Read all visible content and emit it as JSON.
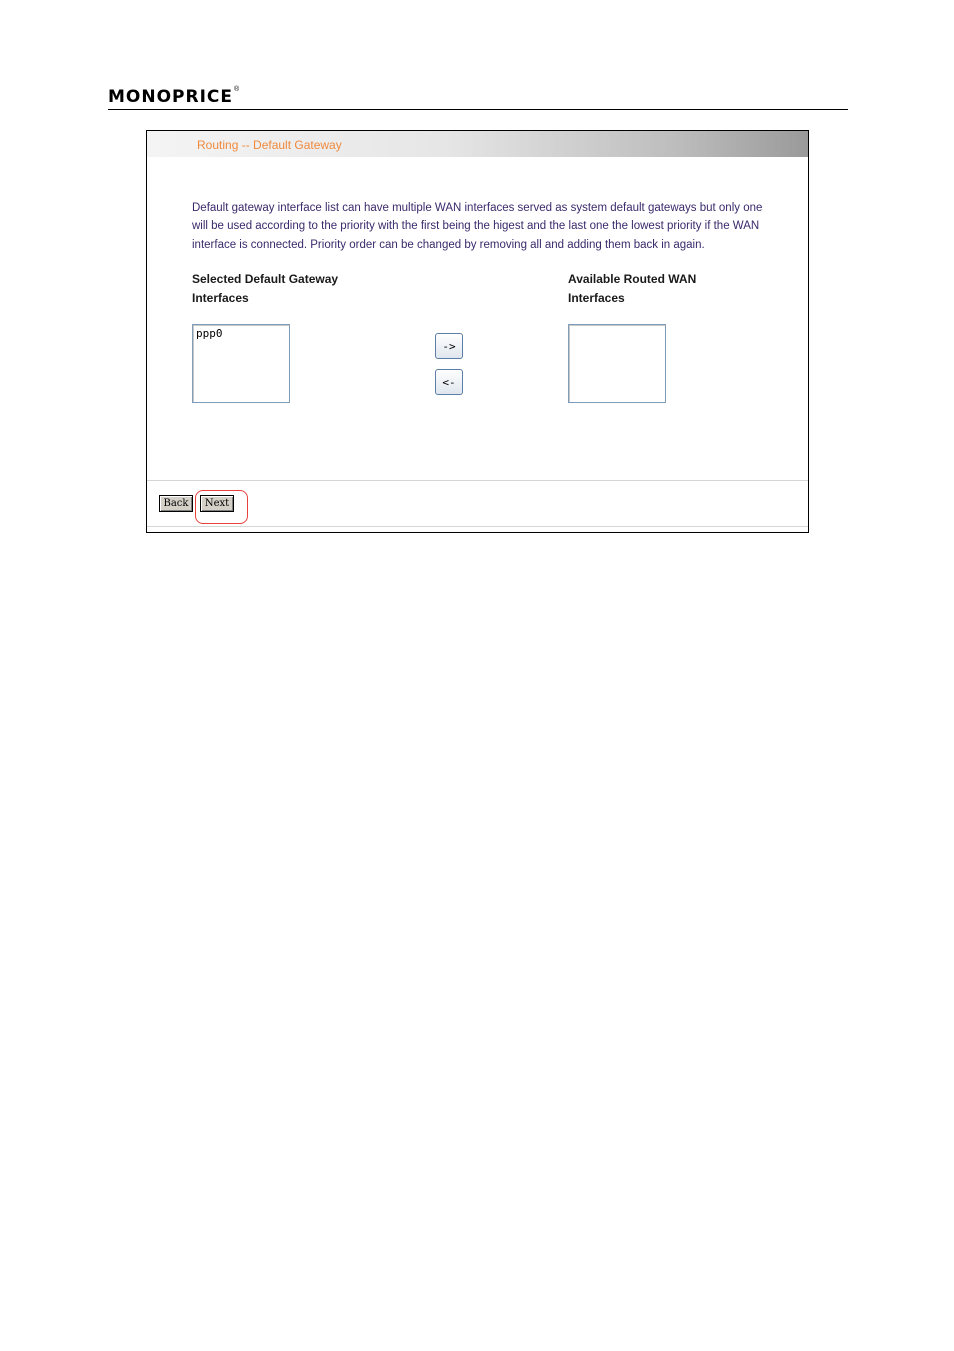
{
  "header": {
    "brand": "MONOPRICE",
    "trademark": "®"
  },
  "screen": {
    "title": "Routing -- Default Gateway",
    "description": [
      "Default gateway interface list can have multiple WAN interfaces served as system default gateways but only one",
      "will be used according to the priority with the first being the higest and the last one the lowest priority if the WAN",
      "interface is connected. Priority order can be changed by removing all and adding them back in again."
    ],
    "selected": {
      "label_line1": "Selected Default Gateway",
      "label_line2": "Interfaces",
      "options": [
        "ppp0"
      ]
    },
    "available": {
      "label_line1": "Available Routed WAN",
      "label_line2": "Interfaces",
      "options": []
    },
    "add_button": "->",
    "remove_button": "<-",
    "back_button": "Back",
    "next_button": "Next"
  },
  "colors": {
    "title": "#f08a3c",
    "description": "#3a2a6b",
    "highlight": "#e8413c"
  }
}
